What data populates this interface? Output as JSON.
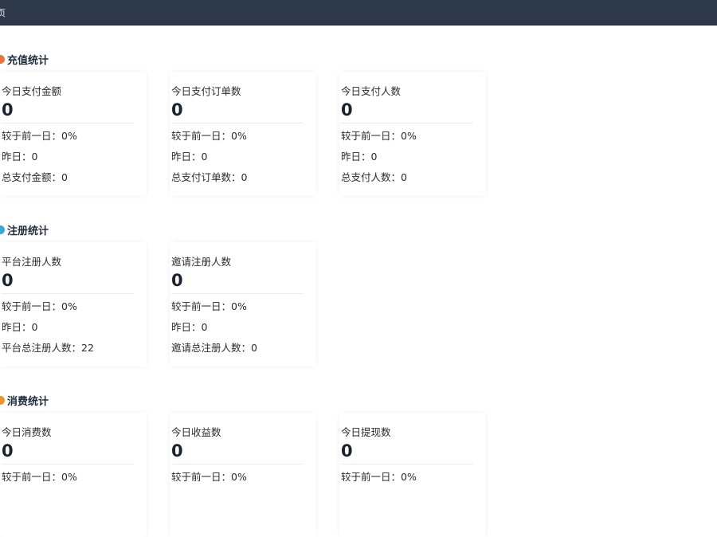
{
  "topbar": {
    "crumb": "页"
  },
  "sections": [
    {
      "title": "充值统计",
      "icon": "coin-icon",
      "icon_color": "#e8743b",
      "cards": [
        {
          "title": "今日支付金额",
          "value": "0",
          "compare": "较于前一日：0%",
          "yesterday": "昨日：0",
          "total": "总支付金额：0"
        },
        {
          "title": "今日支付订单数",
          "value": "0",
          "compare": "较于前一日：0%",
          "yesterday": "昨日：0",
          "total": "总支付订单数：0"
        },
        {
          "title": "今日支付人数",
          "value": "0",
          "compare": "较于前一日：0%",
          "yesterday": "昨日：0",
          "total": "总支付人数：0"
        }
      ]
    },
    {
      "title": "注册统计",
      "icon": "user-icon",
      "icon_color": "#3aa6d9",
      "cards": [
        {
          "title": "平台注册人数",
          "value": "0",
          "compare": "较于前一日：0%",
          "yesterday": "昨日：0",
          "total": "平台总注册人数：22"
        },
        {
          "title": "邀请注册人数",
          "value": "0",
          "compare": "较于前一日：0%",
          "yesterday": "昨日：0",
          "total": "邀请总注册人数：0"
        }
      ]
    },
    {
      "title": "消费统计",
      "icon": "consume-icon",
      "icon_color": "#f0932b",
      "cards": [
        {
          "title": "今日消费数",
          "value": "0",
          "compare": "较于前一日：0%"
        },
        {
          "title": "今日收益数",
          "value": "0",
          "compare": "较于前一日：0%"
        },
        {
          "title": "今日提现数",
          "value": "0",
          "compare": "较于前一日：0%"
        }
      ]
    }
  ]
}
